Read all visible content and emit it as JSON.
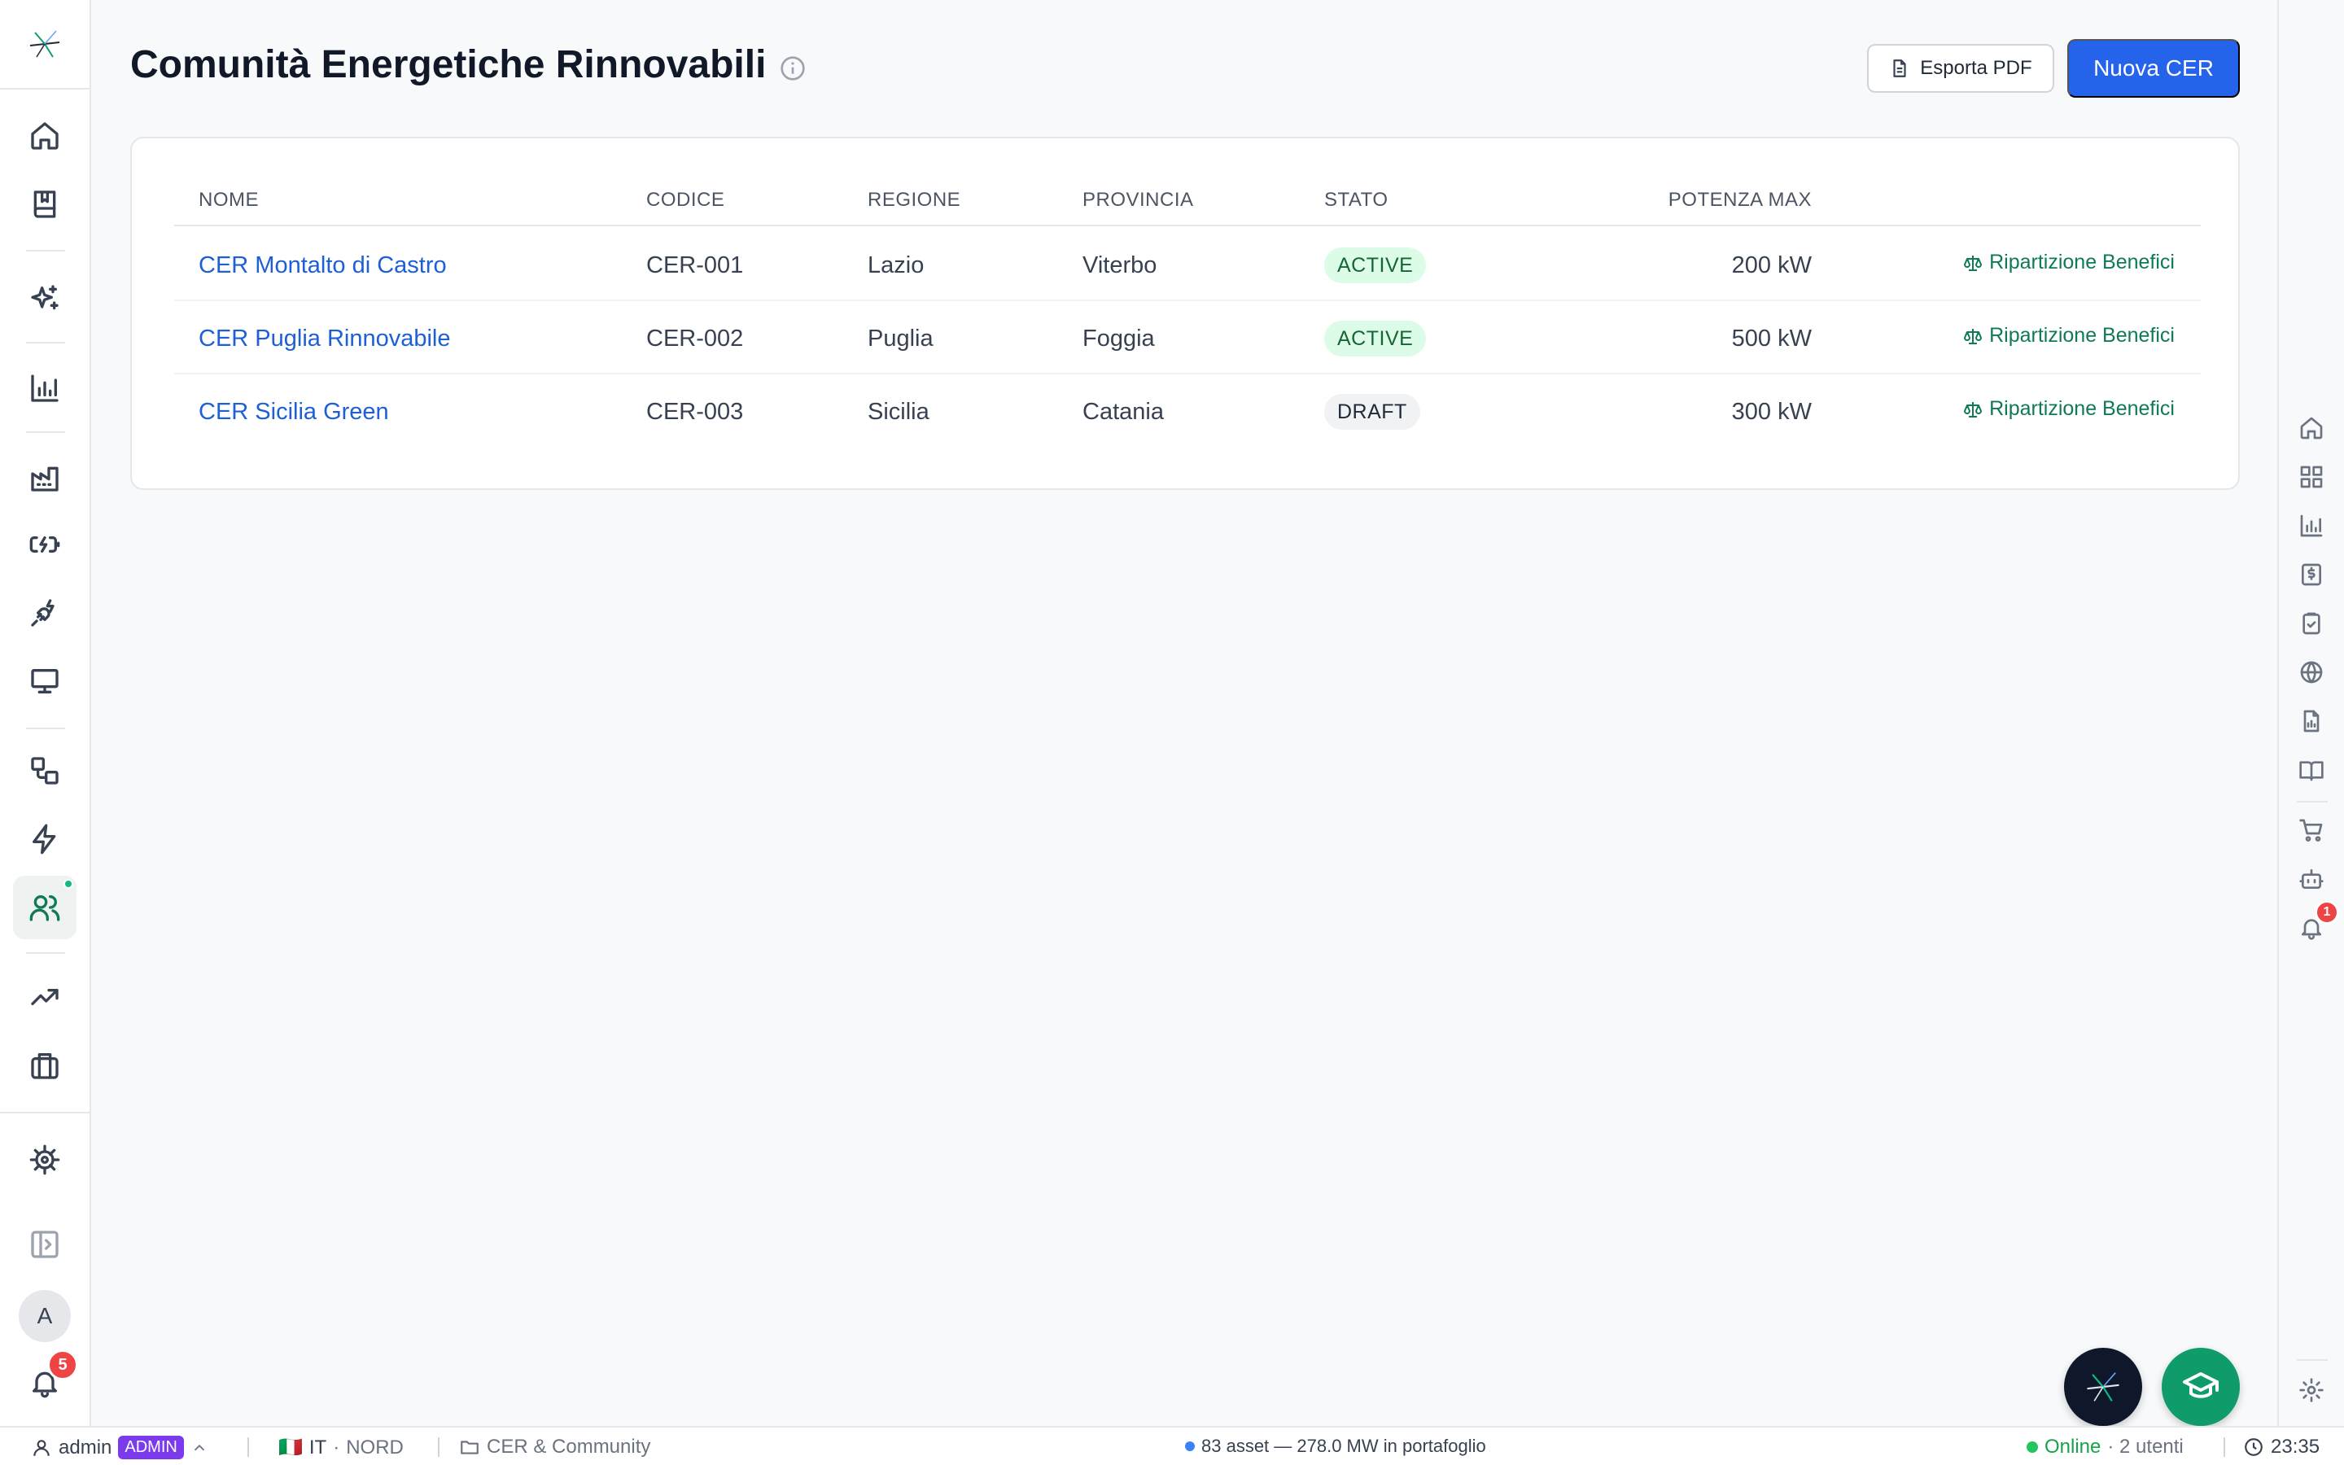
{
  "page": {
    "title": "Comunità Energetiche Rinnovabili",
    "export_label": "Esporta PDF",
    "new_label": "Nuova CER"
  },
  "table": {
    "columns": [
      "NOME",
      "CODICE",
      "REGIONE",
      "PROVINCIA",
      "STATO",
      "POTENZA MAX"
    ],
    "rows": [
      {
        "name": "CER Montalto di Castro",
        "code": "CER-001",
        "region": "Lazio",
        "province": "Viterbo",
        "status": "ACTIVE",
        "status_kind": "active",
        "power": "200 kW",
        "action": "Ripartizione Benefici"
      },
      {
        "name": "CER Puglia Rinnovabile",
        "code": "CER-002",
        "region": "Puglia",
        "province": "Foggia",
        "status": "ACTIVE",
        "status_kind": "active",
        "power": "500 kW",
        "action": "Ripartizione Benefici"
      },
      {
        "name": "CER Sicilia Green",
        "code": "CER-003",
        "region": "Sicilia",
        "province": "Catania",
        "status": "DRAFT",
        "status_kind": "draft",
        "power": "300 kW",
        "action": "Ripartizione Benefici"
      }
    ]
  },
  "sidebar": {
    "avatar_initial": "A",
    "notifications_count": "5"
  },
  "rail": {
    "notifications_count": "1"
  },
  "statusbar": {
    "user": "admin",
    "role": "ADMIN",
    "country_flag": "🇮🇹",
    "country": "IT",
    "zone": "NORD",
    "section": "CER & Community",
    "portfolio": "83 asset — 278.0 MW in portafoglio",
    "online": "Online",
    "users": "· 2 utenti",
    "time": "23:35"
  },
  "colors": {
    "primary": "#2563eb",
    "accent_green": "#0f7a55",
    "active_pill_bg": "#dcfce7",
    "admin_badge": "#7c3aed",
    "alert_red": "#ef4444"
  }
}
